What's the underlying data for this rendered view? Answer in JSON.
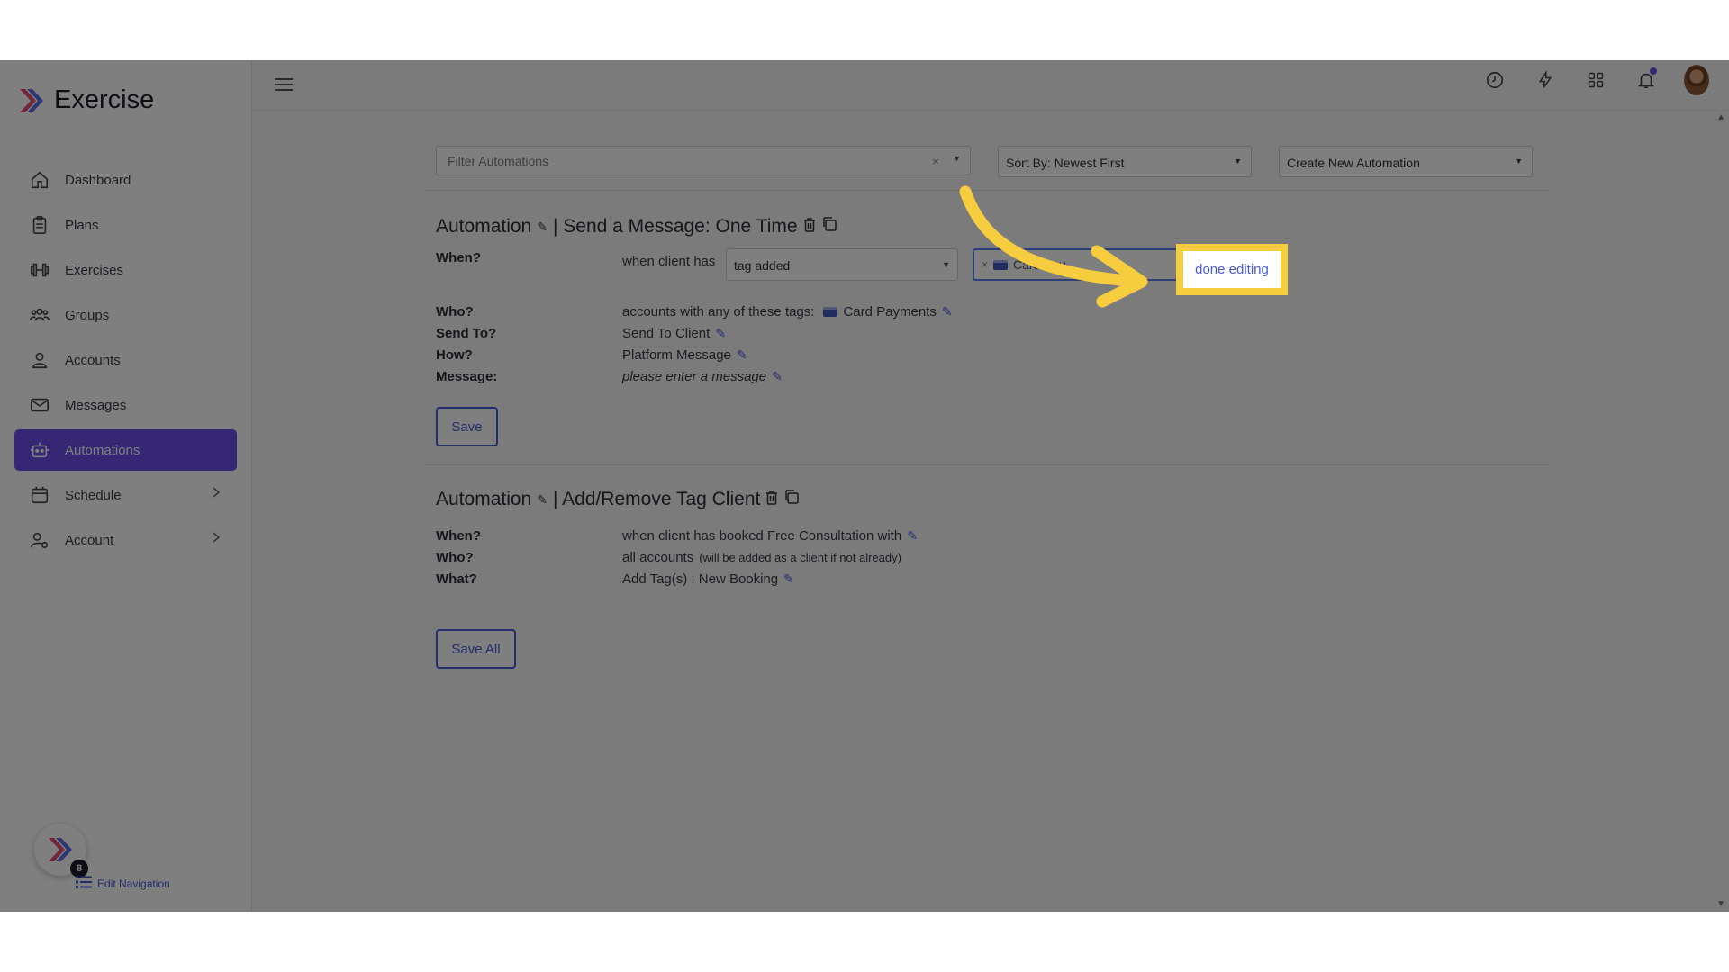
{
  "app": {
    "brand_name": "Exercise"
  },
  "sidebar": {
    "items": [
      {
        "label": "Dashboard",
        "icon": "home-icon"
      },
      {
        "label": "Plans",
        "icon": "clipboard-icon"
      },
      {
        "label": "Exercises",
        "icon": "dumbbell-icon"
      },
      {
        "label": "Groups",
        "icon": "users-icon"
      },
      {
        "label": "Accounts",
        "icon": "user-icon"
      },
      {
        "label": "Messages",
        "icon": "mail-icon"
      },
      {
        "label": "Automations",
        "icon": "robot-icon",
        "active": true
      },
      {
        "label": "Schedule",
        "icon": "calendar-icon",
        "has_submenu": true
      },
      {
        "label": "Account",
        "icon": "user-gear-icon",
        "has_submenu": true
      }
    ],
    "edit_navigation_label": "Edit Navigation",
    "notification_count": "8"
  },
  "topbar": {
    "icons": [
      "menu-icon",
      "clock-icon",
      "bolt-icon",
      "grid-icon",
      "bell-icon",
      "avatar"
    ]
  },
  "filters": {
    "filter_placeholder": "Filter Automations",
    "clear_glyph": "×",
    "sort_label": "Sort By: Newest First",
    "create_label": "Create New Automation"
  },
  "automations": [
    {
      "prefix": "Automation",
      "title": "| Send a Message: One Time",
      "when_label": "When?",
      "when_text": "when client has",
      "when_select": "tag added",
      "tag_input_value": "Card Pay",
      "who_label": "Who?",
      "who_value": "accounts with any of these tags:",
      "who_tag": "Card Payments",
      "send_to_label": "Send To?",
      "send_to_value": "Send To Client",
      "how_label": "How?",
      "how_value": "Platform Message",
      "message_label": "Message:",
      "message_value": "please enter a message",
      "save_label": "Save"
    },
    {
      "prefix": "Automation",
      "title": "| Add/Remove Tag Client",
      "when_label": "When?",
      "when_value": "when client has booked Free Consultation with",
      "who_label": "Who?",
      "who_value": "all accounts",
      "who_note": "(will be added as a client if not already)",
      "what_label": "What?",
      "what_value": "Add Tag(s) : New Booking"
    }
  ],
  "save_all_label": "Save All",
  "done_editing_label": "done editing",
  "colors": {
    "accent": "#6b4ee6",
    "link": "#4a5bd8",
    "highlight": "#f6cd3e"
  }
}
